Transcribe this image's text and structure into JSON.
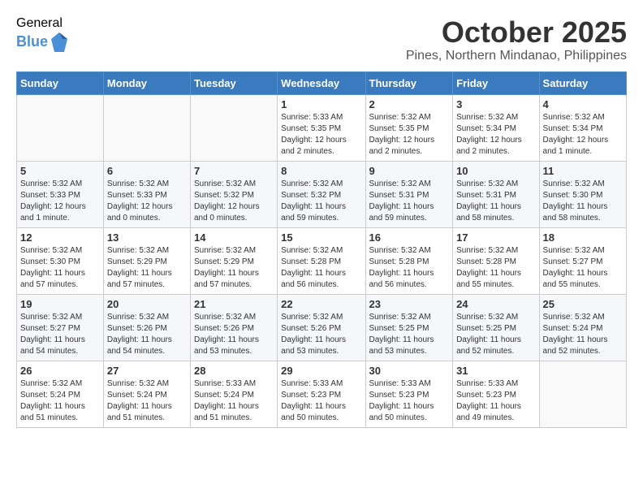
{
  "logo": {
    "general": "General",
    "blue": "Blue"
  },
  "title": "October 2025",
  "location": "Pines, Northern Mindanao, Philippines",
  "headers": [
    "Sunday",
    "Monday",
    "Tuesday",
    "Wednesday",
    "Thursday",
    "Friday",
    "Saturday"
  ],
  "weeks": [
    [
      {
        "day": "",
        "info": ""
      },
      {
        "day": "",
        "info": ""
      },
      {
        "day": "",
        "info": ""
      },
      {
        "day": "1",
        "info": "Sunrise: 5:33 AM\nSunset: 5:35 PM\nDaylight: 12 hours\nand 2 minutes."
      },
      {
        "day": "2",
        "info": "Sunrise: 5:32 AM\nSunset: 5:35 PM\nDaylight: 12 hours\nand 2 minutes."
      },
      {
        "day": "3",
        "info": "Sunrise: 5:32 AM\nSunset: 5:34 PM\nDaylight: 12 hours\nand 2 minutes."
      },
      {
        "day": "4",
        "info": "Sunrise: 5:32 AM\nSunset: 5:34 PM\nDaylight: 12 hours\nand 1 minute."
      }
    ],
    [
      {
        "day": "5",
        "info": "Sunrise: 5:32 AM\nSunset: 5:33 PM\nDaylight: 12 hours\nand 1 minute."
      },
      {
        "day": "6",
        "info": "Sunrise: 5:32 AM\nSunset: 5:33 PM\nDaylight: 12 hours\nand 0 minutes."
      },
      {
        "day": "7",
        "info": "Sunrise: 5:32 AM\nSunset: 5:32 PM\nDaylight: 12 hours\nand 0 minutes."
      },
      {
        "day": "8",
        "info": "Sunrise: 5:32 AM\nSunset: 5:32 PM\nDaylight: 11 hours\nand 59 minutes."
      },
      {
        "day": "9",
        "info": "Sunrise: 5:32 AM\nSunset: 5:31 PM\nDaylight: 11 hours\nand 59 minutes."
      },
      {
        "day": "10",
        "info": "Sunrise: 5:32 AM\nSunset: 5:31 PM\nDaylight: 11 hours\nand 58 minutes."
      },
      {
        "day": "11",
        "info": "Sunrise: 5:32 AM\nSunset: 5:30 PM\nDaylight: 11 hours\nand 58 minutes."
      }
    ],
    [
      {
        "day": "12",
        "info": "Sunrise: 5:32 AM\nSunset: 5:30 PM\nDaylight: 11 hours\nand 57 minutes."
      },
      {
        "day": "13",
        "info": "Sunrise: 5:32 AM\nSunset: 5:29 PM\nDaylight: 11 hours\nand 57 minutes."
      },
      {
        "day": "14",
        "info": "Sunrise: 5:32 AM\nSunset: 5:29 PM\nDaylight: 11 hours\nand 57 minutes."
      },
      {
        "day": "15",
        "info": "Sunrise: 5:32 AM\nSunset: 5:28 PM\nDaylight: 11 hours\nand 56 minutes."
      },
      {
        "day": "16",
        "info": "Sunrise: 5:32 AM\nSunset: 5:28 PM\nDaylight: 11 hours\nand 56 minutes."
      },
      {
        "day": "17",
        "info": "Sunrise: 5:32 AM\nSunset: 5:28 PM\nDaylight: 11 hours\nand 55 minutes."
      },
      {
        "day": "18",
        "info": "Sunrise: 5:32 AM\nSunset: 5:27 PM\nDaylight: 11 hours\nand 55 minutes."
      }
    ],
    [
      {
        "day": "19",
        "info": "Sunrise: 5:32 AM\nSunset: 5:27 PM\nDaylight: 11 hours\nand 54 minutes."
      },
      {
        "day": "20",
        "info": "Sunrise: 5:32 AM\nSunset: 5:26 PM\nDaylight: 11 hours\nand 54 minutes."
      },
      {
        "day": "21",
        "info": "Sunrise: 5:32 AM\nSunset: 5:26 PM\nDaylight: 11 hours\nand 53 minutes."
      },
      {
        "day": "22",
        "info": "Sunrise: 5:32 AM\nSunset: 5:26 PM\nDaylight: 11 hours\nand 53 minutes."
      },
      {
        "day": "23",
        "info": "Sunrise: 5:32 AM\nSunset: 5:25 PM\nDaylight: 11 hours\nand 53 minutes."
      },
      {
        "day": "24",
        "info": "Sunrise: 5:32 AM\nSunset: 5:25 PM\nDaylight: 11 hours\nand 52 minutes."
      },
      {
        "day": "25",
        "info": "Sunrise: 5:32 AM\nSunset: 5:24 PM\nDaylight: 11 hours\nand 52 minutes."
      }
    ],
    [
      {
        "day": "26",
        "info": "Sunrise: 5:32 AM\nSunset: 5:24 PM\nDaylight: 11 hours\nand 51 minutes."
      },
      {
        "day": "27",
        "info": "Sunrise: 5:32 AM\nSunset: 5:24 PM\nDaylight: 11 hours\nand 51 minutes."
      },
      {
        "day": "28",
        "info": "Sunrise: 5:33 AM\nSunset: 5:24 PM\nDaylight: 11 hours\nand 51 minutes."
      },
      {
        "day": "29",
        "info": "Sunrise: 5:33 AM\nSunset: 5:23 PM\nDaylight: 11 hours\nand 50 minutes."
      },
      {
        "day": "30",
        "info": "Sunrise: 5:33 AM\nSunset: 5:23 PM\nDaylight: 11 hours\nand 50 minutes."
      },
      {
        "day": "31",
        "info": "Sunrise: 5:33 AM\nSunset: 5:23 PM\nDaylight: 11 hours\nand 49 minutes."
      },
      {
        "day": "",
        "info": ""
      }
    ]
  ]
}
